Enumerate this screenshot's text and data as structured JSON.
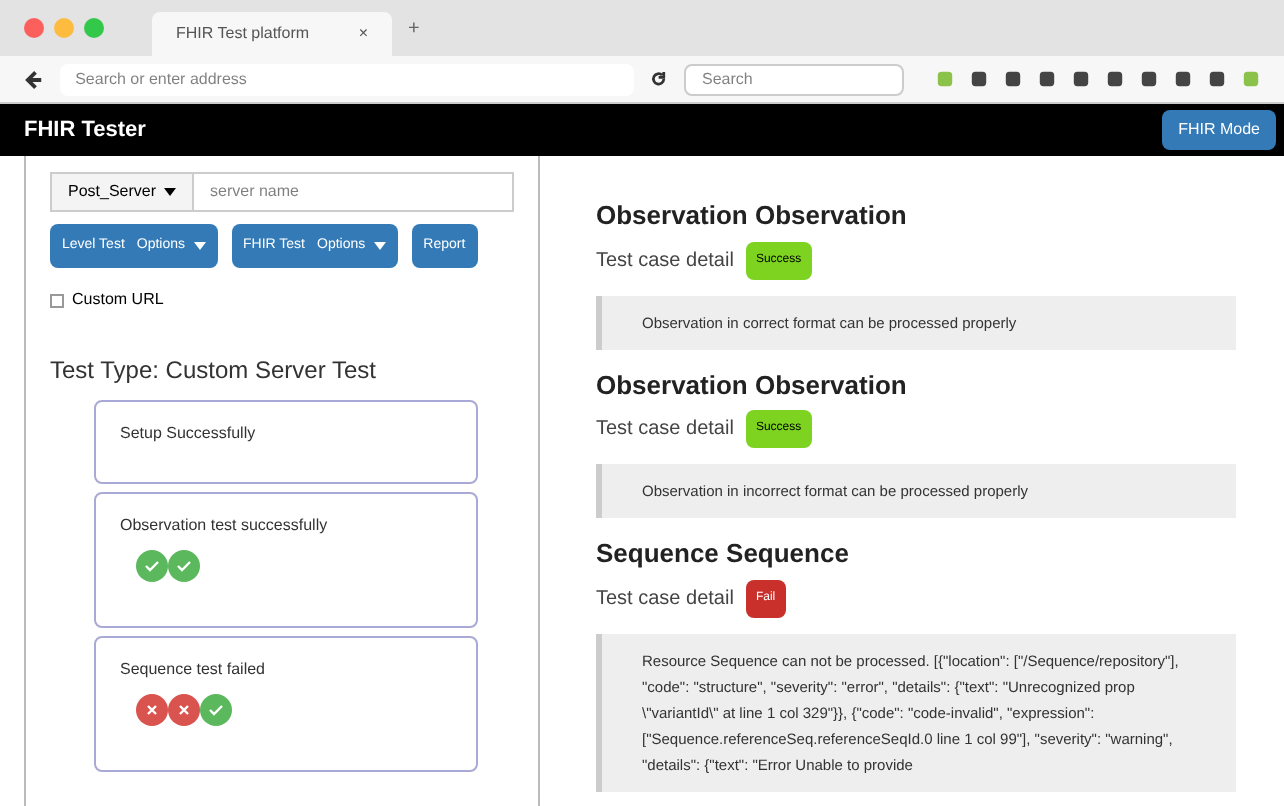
{
  "browser": {
    "tab_title": "FHIR Test platform",
    "tab_close": "×",
    "new_tab": "+",
    "address_placeholder": "Search or enter address",
    "search_placeholder": "Search"
  },
  "navbar": {
    "brand": "FHIR Tester",
    "mode_button": "FHIR Mode"
  },
  "sidebar": {
    "server_dropdown": "Post_Server",
    "server_placeholder": "server name",
    "buttons": [
      {
        "label": "Level Test",
        "options": "Options"
      },
      {
        "label": "FHIR Test",
        "options": "Options"
      },
      {
        "label": "Report"
      }
    ],
    "custom_url": {
      "label": "Custom URL",
      "checked": false
    },
    "test_type": "Test Type: Custom Server Test",
    "results": [
      {
        "title": "Setup Successfully"
      },
      {
        "title": "Observation test successfully",
        "steps": [
          {
            "passed": true
          },
          {
            "passed": true
          }
        ]
      },
      {
        "title": "Sequence test failed",
        "steps": [
          {
            "passed": false
          },
          {
            "passed": false
          },
          {
            "passed": true
          }
        ]
      }
    ]
  },
  "details": [
    {
      "title": "Observation Observation",
      "label": "Test case detail",
      "badge": "Success",
      "passed": true,
      "message": "Observation in correct format can be processed properly"
    },
    {
      "title": "Observation Observation",
      "label": "Test case detail",
      "badge": "Success",
      "passed": true,
      "message": "Observation in incorrect format can be processed properly"
    },
    {
      "title": "Sequence Sequence",
      "label": "Test case detail",
      "badge": "Fail",
      "passed": false,
      "message": "Resource Sequence can not be processed. [{\"location\": [\"/Sequence/repository\"], \"code\": \"structure\", \"severity\": \"error\", \"details\": {\"text\": \"Unrecognized prop \\\"variantId\\\" at line 1 col 329\"}}, {\"code\": \"code-invalid\", \"expression\": [\"Sequence.referenceSeq.referenceSeqId.0 line 1 col 99\"], \"severity\": \"warning\", \"details\": {\"text\": \"Error Unable to provide"
    }
  ]
}
